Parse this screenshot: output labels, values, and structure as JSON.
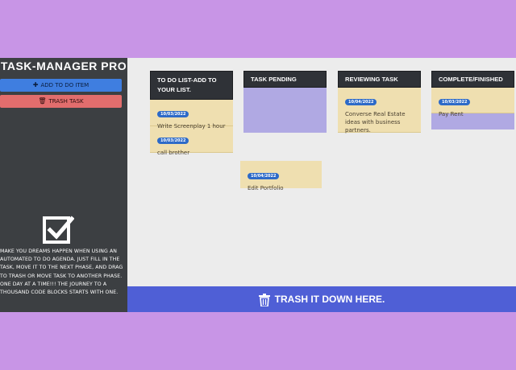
{
  "app": {
    "title": "TASK-MANAGER PRO",
    "add_button": "ADD TO DO ITEM",
    "trash_button": "TRASH TASK",
    "blurb": "MAKE YOU DREAMS HAPPEN WHEN USING AN AUTOMATED TO DO AGENDA. JUST FILL IN THE TASK, MOVE IT TO THE NEXT PHASE, AND DRAG TO TRASH OR MOVE TASK TO ANOTHER PHASE. ONE DAY AT A TIME!!! THE JOURNEY TO A THOUSAND CODE BLOCKS STARTS WITH ONE.",
    "drop_zone": "TRASH IT DOWN HERE."
  },
  "columns": {
    "todo": {
      "title": "TO DO LIST-ADD TO YOUR LIST.",
      "cards": [
        {
          "date": "10/03/2022",
          "text": "Write Screenplay 1 hour"
        },
        {
          "date": "10/03/2022",
          "text": "call brother"
        }
      ]
    },
    "pending": {
      "title": "TASK PENDING"
    },
    "review": {
      "title": "REVIEWING TASK",
      "cards": [
        {
          "date": "10/04/2022",
          "text": "Converse Real Estate ideas with business partners."
        }
      ]
    },
    "complete": {
      "title": "COMPLETE/FINISHED",
      "cards": [
        {
          "date": "10/03/2022",
          "text": "Pay Rent"
        }
      ]
    }
  },
  "dragging_card": {
    "date": "10/04/2022",
    "text": "Edit Portfolio"
  },
  "colors": {
    "background": "#c895e6",
    "sidebar": "#3c3f42",
    "add_button": "#3f7ee0",
    "trash_button": "#e26d6d",
    "card": "#efdfb0",
    "empty_column": "#b0a9e3",
    "drop_zone": "#4f5fd6",
    "badge": "#2d6ac8"
  }
}
